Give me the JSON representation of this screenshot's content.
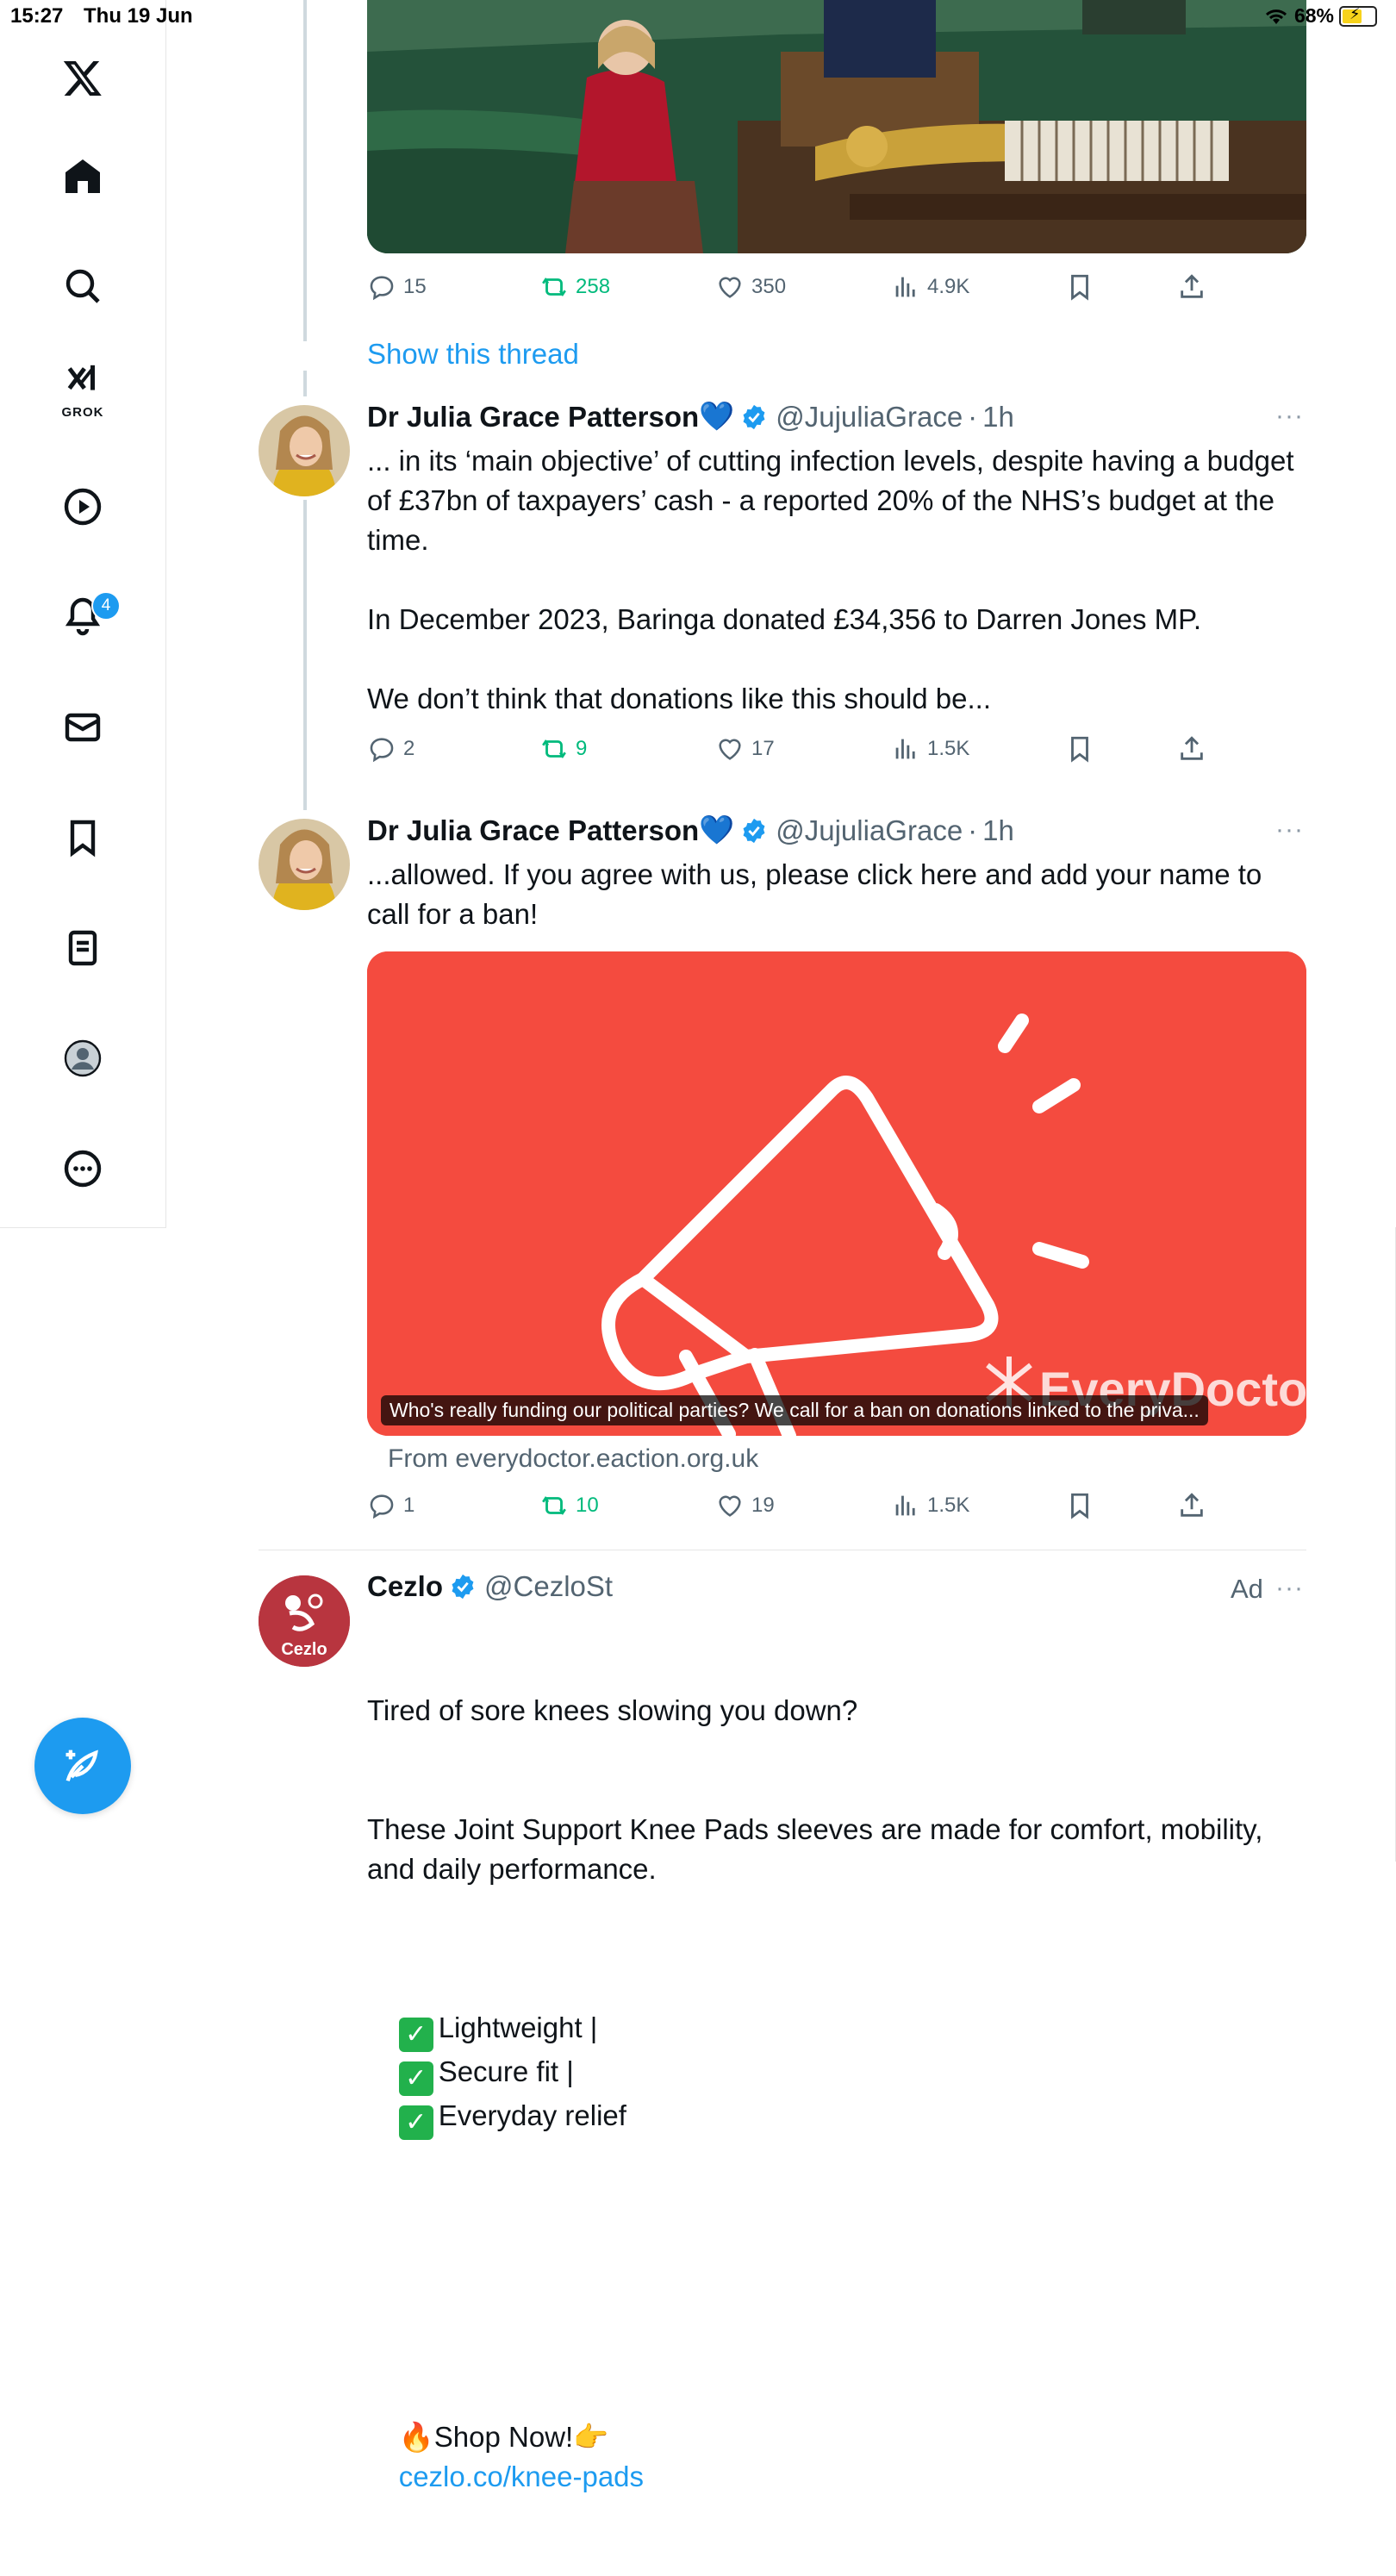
{
  "status_bar": {
    "time": "15:27",
    "date": "Thu 19 Jun",
    "battery": "68%"
  },
  "sidebar": {
    "items": [
      {
        "name": "x-logo-icon"
      },
      {
        "name": "home-icon"
      },
      {
        "name": "search-icon"
      },
      {
        "name": "grok-icon",
        "label": "GROK"
      },
      {
        "name": "video-icon"
      },
      {
        "name": "notifications-icon",
        "badge": "4"
      },
      {
        "name": "messages-icon"
      },
      {
        "name": "bookmarks-icon"
      },
      {
        "name": "lists-icon"
      },
      {
        "name": "profile-icon"
      },
      {
        "name": "more-icon"
      }
    ],
    "compose_icon": "compose-icon"
  },
  "tweet0": {
    "actions": {
      "replies": "15",
      "reposts": "258",
      "likes": "350",
      "views": "4.9K"
    },
    "show_thread": "Show this thread"
  },
  "tweet1": {
    "name": "Dr Julia Grace Patterson",
    "emoji": "💙",
    "handle": "@JujuliaGrace",
    "time": "1h",
    "text": "... in its ‘main objective’ of cutting infection levels, despite having a budget of £37bn of taxpayers’ cash - a reported 20% of the NHS’s budget at the time.\n\nIn December 2023, Baringa donated £34,356 to Darren Jones MP.\n\nWe don’t think that donations like this should be...",
    "actions": {
      "replies": "2",
      "reposts": "9",
      "likes": "17",
      "views": "1.5K"
    }
  },
  "tweet2": {
    "name": "Dr Julia Grace Patterson",
    "emoji": "💙",
    "handle": "@JujuliaGrace",
    "time": "1h",
    "text": "...allowed. If you agree with us, please click here and add your name to call for a ban!",
    "card_caption": "Who's really funding our political parties? We call for a ban on donations linked to the priva...",
    "card_watermark": "EveryDoctor",
    "card_from": "From everydoctor.eaction.org.uk",
    "actions": {
      "replies": "1",
      "reposts": "10",
      "likes": "19",
      "views": "1.5K"
    }
  },
  "tweet3": {
    "name": "Cezlo",
    "handle": "@CezloSt",
    "ad_label": "Ad",
    "avatar_text": "Cezlo",
    "line1": "Tired of sore knees slowing you down?",
    "line2": "These Joint Support Knee Pads sleeves are made for comfort, mobility, and daily performance.",
    "feature1": "Lightweight |",
    "feature2": "Secure fit |",
    "feature3": "Everyday relief",
    "shop_text": "Shop Now!",
    "link": "cezlo.co/knee-pads"
  },
  "colors": {
    "accent": "#1d9bf0",
    "repost": "#00ba7c",
    "card_red": "#f44b3f",
    "text": "#0f1419",
    "muted": "#536471"
  }
}
